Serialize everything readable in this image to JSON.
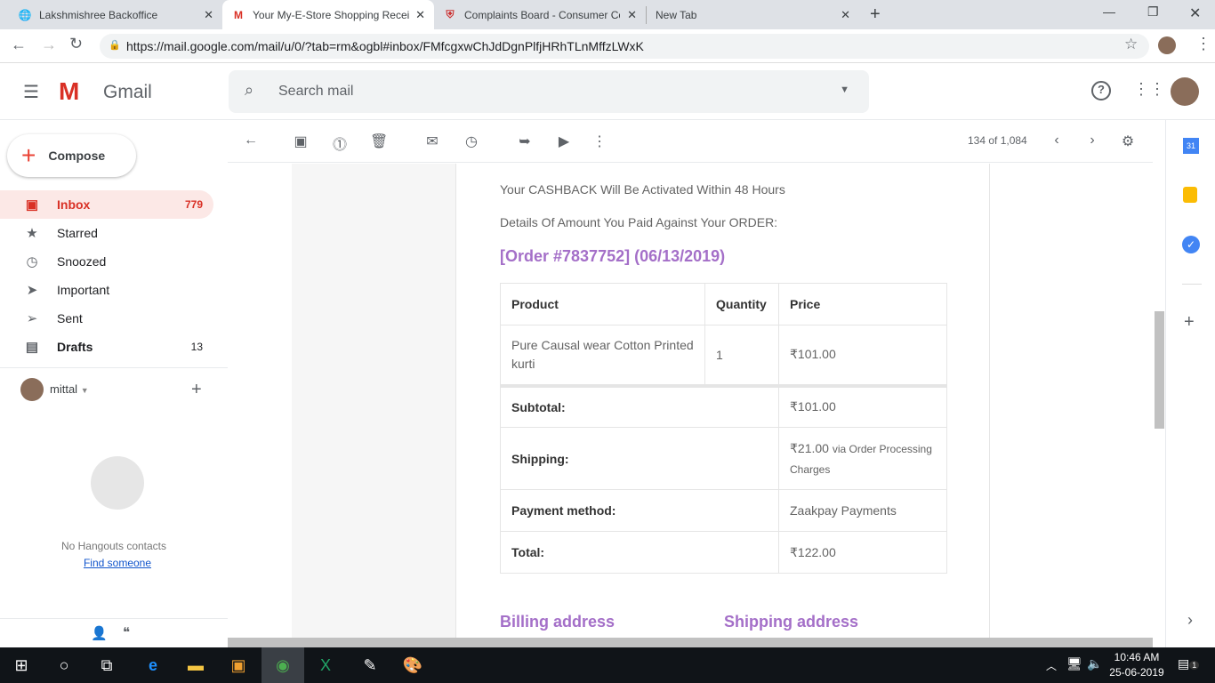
{
  "browser": {
    "tabs": [
      {
        "title": "Lakshmishree Backoffice",
        "active": false
      },
      {
        "title": "Your My-E-Store Shopping Recei",
        "active": true
      },
      {
        "title": "Complaints Board - Consumer Co",
        "active": false
      },
      {
        "title": "New Tab",
        "active": false
      }
    ],
    "url": "https://mail.google.com/mail/u/0/?tab=rm&ogbl#inbox/FMfcgxwChJdDgnPlfjHRhTLnMffzLWxK"
  },
  "gmail": {
    "app_name": "Gmail",
    "search_placeholder": "Search mail",
    "compose": "Compose",
    "nav": [
      {
        "label": "Inbox",
        "count": "779",
        "icon": "inbox-icon"
      },
      {
        "label": "Starred",
        "count": "",
        "icon": "star-icon"
      },
      {
        "label": "Snoozed",
        "count": "",
        "icon": "clock-icon"
      },
      {
        "label": "Important",
        "count": "",
        "icon": "important-icon"
      },
      {
        "label": "Sent",
        "count": "",
        "icon": "send-icon"
      },
      {
        "label": "Drafts",
        "count": "13",
        "icon": "draft-icon"
      }
    ],
    "hangouts": {
      "user": "mittal",
      "empty": "No Hangouts contacts",
      "find": "Find someone"
    },
    "pagination": "134 of 1,084"
  },
  "email": {
    "cashback": "Your CASHBACK Will Be Activated Within 48 Hours",
    "details": "Details Of Amount You Paid Against Your ORDER:",
    "order_title": "[Order #7837752] (06/13/2019)",
    "headers": [
      "Product",
      "Quantity",
      "Price"
    ],
    "item": {
      "product": "Pure Causal wear Cotton Printed kurti",
      "quantity": "1",
      "price": "₹101.00"
    },
    "totals": [
      {
        "label": "Subtotal:",
        "value": "₹101.00",
        "note": ""
      },
      {
        "label": "Shipping:",
        "value": "₹21.00",
        "note": "via Order Processing Charges"
      },
      {
        "label": "Payment method:",
        "value": "Zaakpay Payments",
        "note": ""
      },
      {
        "label": "Total:",
        "value": "₹122.00",
        "note": ""
      }
    ],
    "billing": "Billing address",
    "shipping": "Shipping address"
  },
  "taskbar": {
    "time": "10:46 AM",
    "date": "25-06-2019",
    "notifications": "1"
  },
  "colors": {
    "accent": "#a46fc8",
    "inbox": "#d93025"
  }
}
